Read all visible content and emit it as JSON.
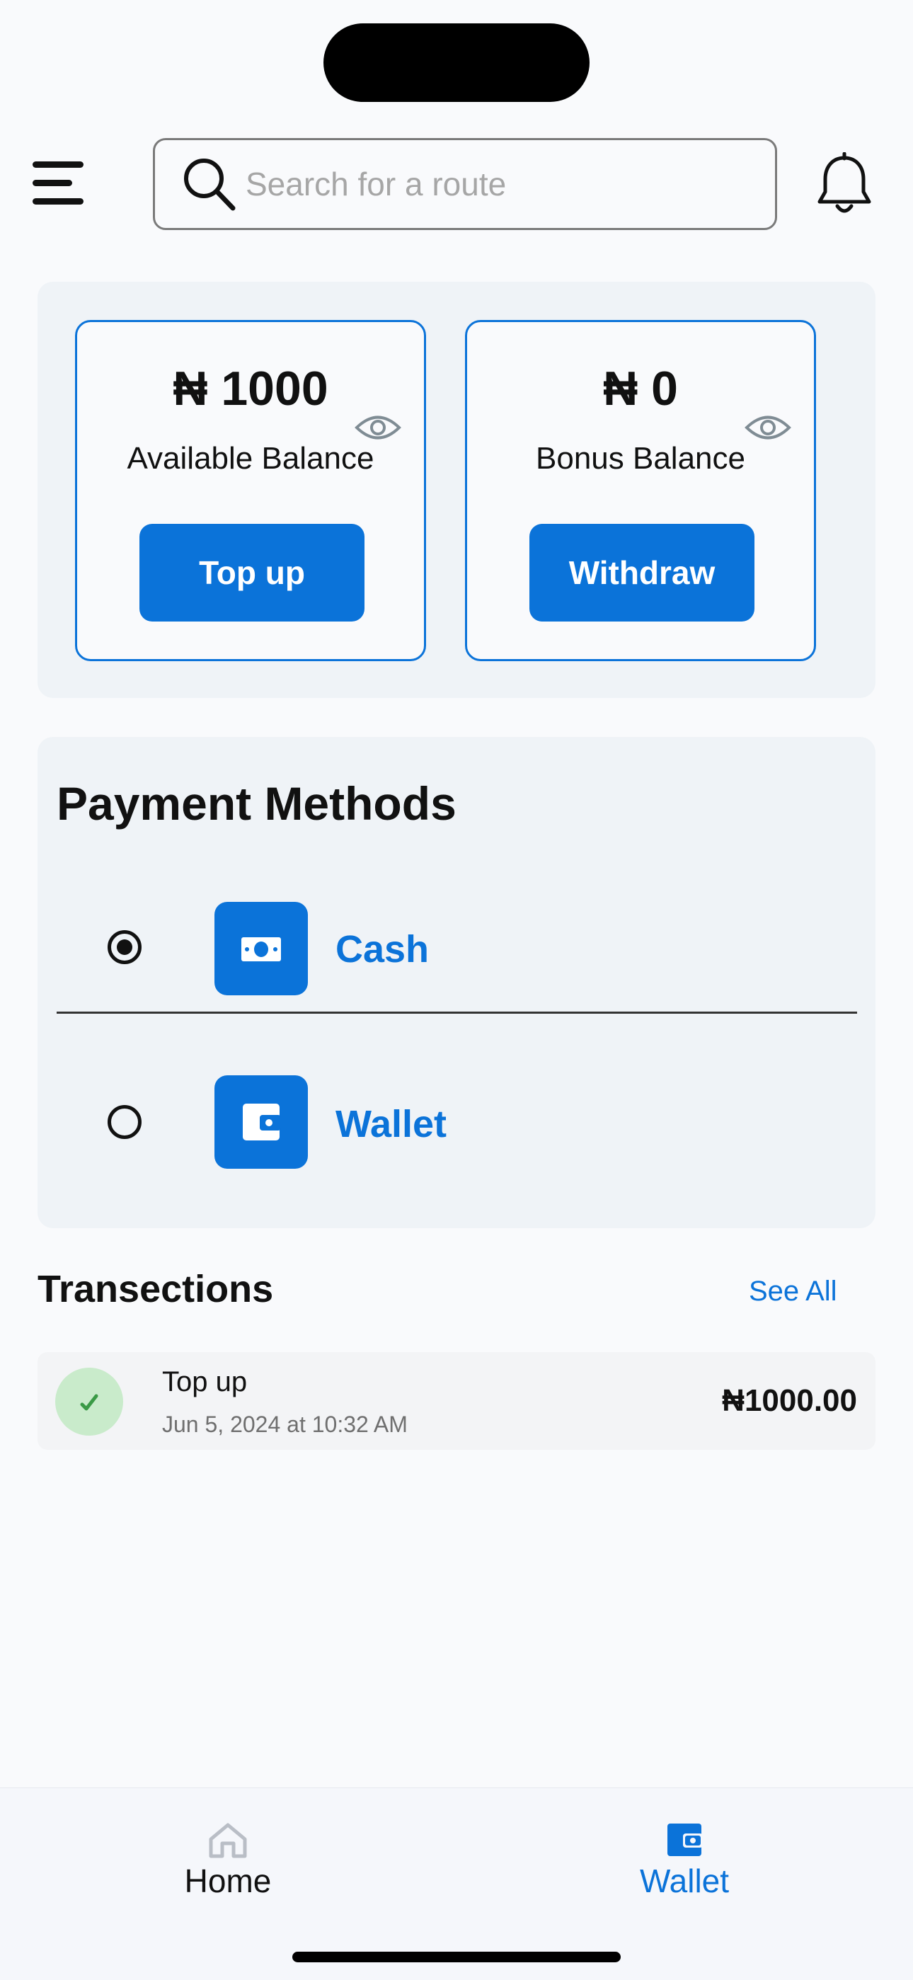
{
  "header": {
    "menu_icon": "hamburger-menu-icon",
    "search": {
      "placeholder": "Search for a route",
      "value": ""
    },
    "notification_icon": "bell-icon"
  },
  "balances": [
    {
      "amount": "₦ 1000",
      "label": "Available Balance",
      "action": "Top up",
      "visibility_icon": "eye-icon"
    },
    {
      "amount": "₦ 0",
      "label": "Bonus Balance",
      "action": "Withdraw",
      "visibility_icon": "eye-icon"
    }
  ],
  "payment_methods": {
    "title": "Payment Methods",
    "selected": "Cash",
    "options": [
      {
        "label": "Cash",
        "icon": "cash-icon",
        "selected": true
      },
      {
        "label": "Wallet",
        "icon": "wallet-icon",
        "selected": false
      }
    ]
  },
  "transactions": {
    "title": "Transections",
    "see_all": "See All",
    "items": [
      {
        "name": "Top up",
        "date": "Jun 5, 2024 at 10:32 AM",
        "amount": "₦1000.00",
        "status_icon": "check-icon"
      }
    ]
  },
  "bottom_nav": {
    "active": "Wallet",
    "items": [
      {
        "label": "Home",
        "icon": "home-icon",
        "active": false
      },
      {
        "label": "Wallet",
        "icon": "wallet-icon",
        "active": true
      }
    ]
  },
  "colors": {
    "accent": "#0b73d9",
    "panel_bg": "#eff3f7",
    "page_bg": "#f9fafc",
    "success_bg": "#c9ebcb",
    "success_fg": "#3a9a46"
  }
}
